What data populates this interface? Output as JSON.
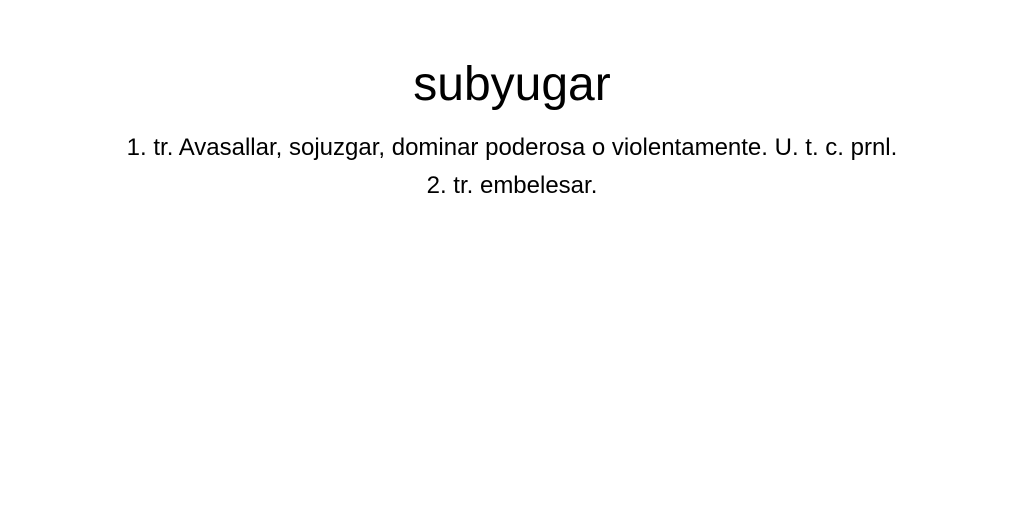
{
  "entry": {
    "term": "subyugar",
    "definitions": [
      "1. tr. Avasallar, sojuzgar, dominar poderosa o violentamente. U. t. c. prnl.",
      "2. tr. embelesar."
    ]
  }
}
